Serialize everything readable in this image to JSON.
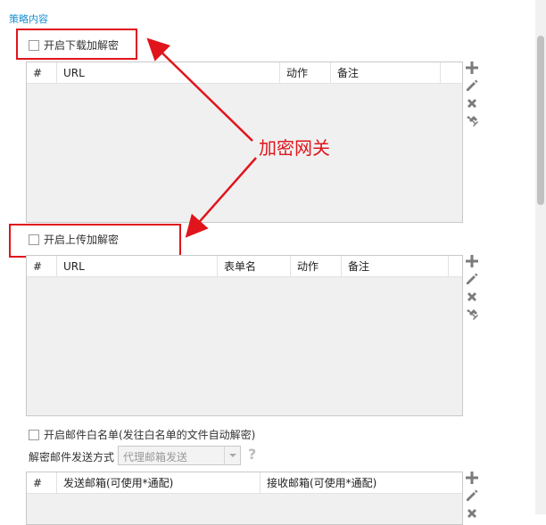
{
  "section": {
    "title": "策略内容"
  },
  "download": {
    "checkbox_label": "开启下载加解密",
    "columns": [
      "#",
      "URL",
      "动作",
      "备注"
    ]
  },
  "upload": {
    "checkbox_label": "开启上传加解密",
    "columns": [
      "#",
      "URL",
      "表单名",
      "动作",
      "备注"
    ]
  },
  "mail": {
    "checkbox_label": "开启邮件白名单(发往白名单的文件自动解密)",
    "send_mode_label": "解密邮件发送方式",
    "send_mode_value": "代理邮箱发送",
    "columns": [
      "#",
      "发送邮箱(可使用*通配)",
      "接收邮箱(可使用*通配)"
    ]
  },
  "annotation": {
    "text": "加密网关",
    "color": "#e0151c"
  },
  "toolbar_icons": [
    "add-icon",
    "edit-icon",
    "delete-icon",
    "clear-icon"
  ],
  "colors": {
    "accent": "#1a8fd0",
    "annotation": "#e0151c"
  }
}
